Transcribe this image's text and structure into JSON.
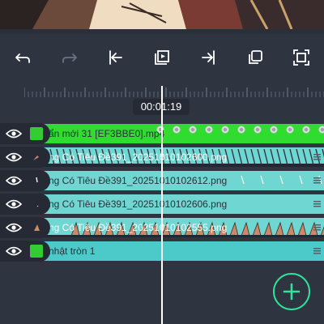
{
  "preview": {
    "description_icon": "video-preview"
  },
  "toolbar": {
    "buttons": [
      {
        "name": "undo",
        "icon": "undo-icon",
        "enabled": true
      },
      {
        "name": "redo",
        "icon": "redo-icon",
        "enabled": false
      },
      {
        "name": "jump-to-start",
        "icon": "skip-start-icon",
        "enabled": true
      },
      {
        "name": "play-preview",
        "icon": "play-frame-icon",
        "enabled": true
      },
      {
        "name": "jump-to-end",
        "icon": "skip-end-icon",
        "enabled": true
      },
      {
        "name": "duplicate",
        "icon": "copy-icon",
        "enabled": true
      },
      {
        "name": "fullscreen",
        "icon": "fullscreen-icon",
        "enabled": true
      }
    ]
  },
  "timeline": {
    "timecode": "00:01:19",
    "tracks": [
      {
        "label": "ẩn mới 31 [EF3BBE0].mp4",
        "type": "video",
        "swatch_color": "#33cc33",
        "clip_color": "#2fdc2f",
        "visible": true
      },
      {
        "label": "ng Có Tiêu Đề391_20251010102600.png",
        "type": "image",
        "clip_color": "#6fd6d2",
        "visible": true
      },
      {
        "label": "ng Có Tiêu Đề391_20251010102612.png",
        "type": "image",
        "clip_color": "#6fd6d2",
        "visible": true
      },
      {
        "label": "ng Có Tiêu Đề391_20251010102606.png",
        "type": "image",
        "clip_color": "#6fd6d2",
        "visible": true
      },
      {
        "label": "ng Có Tiêu Đề391_20251010102555.png",
        "type": "image",
        "clip_color": "#6fd6d2",
        "visible": true
      },
      {
        "label": "nhật tròn 1",
        "type": "shape",
        "swatch_color": "#33cc33",
        "clip_color": "#4cc9c9",
        "visible": true
      }
    ]
  },
  "add_button": {
    "icon": "plus-icon",
    "accent": "#2fe39a"
  }
}
